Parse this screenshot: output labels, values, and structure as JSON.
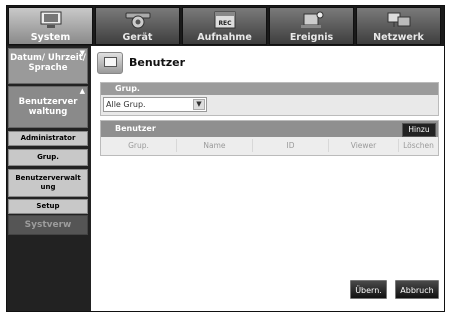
{
  "tabs": [
    {
      "label": "System",
      "icon": "monitor-icon",
      "active": true
    },
    {
      "label": "Gerät",
      "icon": "camera-icon",
      "active": false
    },
    {
      "label": "Aufnahme",
      "icon": "rec-icon",
      "active": false
    },
    {
      "label": "Ereignis",
      "icon": "event-icon",
      "active": false
    },
    {
      "label": "Netzwerk",
      "icon": "network-icon",
      "active": false
    }
  ],
  "sidebar": {
    "datum": "Datum/ Uhrzeit/ Sprache",
    "benutzerverwaltung": "Benutzerver waltung",
    "items": [
      "Administrator",
      "Grup.",
      "Benutzerverwalt ung",
      "Setup"
    ],
    "systverw": "Systverw"
  },
  "page": {
    "title": "Benutzer",
    "icon": "user-monitor-icon"
  },
  "group": {
    "header": "Grup.",
    "selected": "Alle Grup."
  },
  "users": {
    "header": "Benutzer",
    "add_label": "Hinzu",
    "columns": [
      "Grup.",
      "Name",
      "ID",
      "Viewer",
      "Löschen"
    ]
  },
  "buttons": {
    "apply": "Übern.",
    "cancel": "Abbruch"
  },
  "colors": {
    "tab_active": "#b0b0b0",
    "tab_inactive": "#555555",
    "section_header": "#9b9b9b",
    "button": "#222222"
  }
}
